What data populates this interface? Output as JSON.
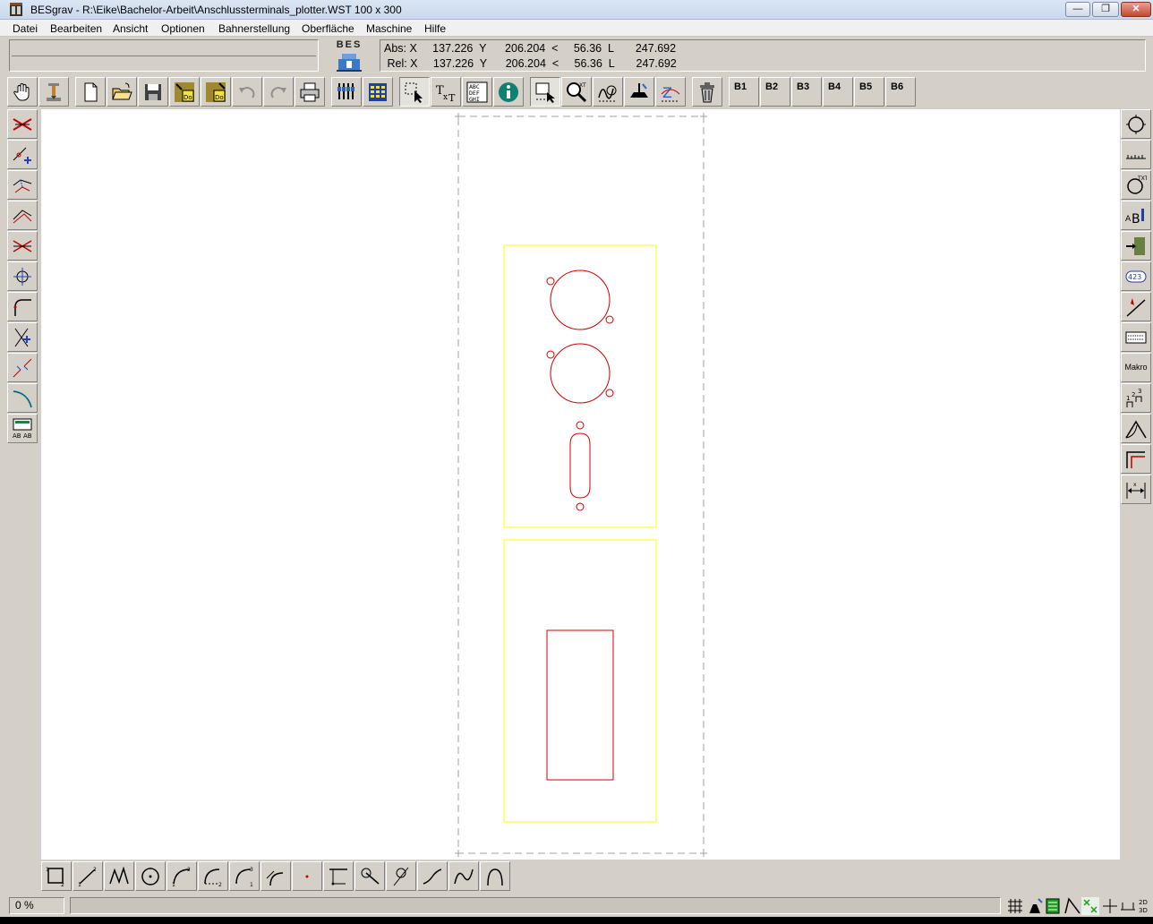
{
  "window": {
    "title": "BESgrav - R:\\Eike\\Bachelor-Arbeit\\Anschlussterminals_plotter.WST   100 x 300",
    "minimize_label": "—",
    "maximize_label": "❐",
    "close_label": "✕"
  },
  "menu": [
    {
      "label": "Datei"
    },
    {
      "label": "Bearbeiten"
    },
    {
      "label": "Ansicht"
    },
    {
      "label": "Optionen"
    },
    {
      "label": "Bahnerstellung"
    },
    {
      "label": "Oberfläche"
    },
    {
      "label": "Maschine"
    },
    {
      "label": "Hilfe"
    }
  ],
  "logo_text": "BES",
  "coords": {
    "abs_line": "Abs: X     137.226  Y      206.204  <     56.36  L       247.692",
    "rel_line": " Rel: X     137.226  Y      206.204  <     56.36  L       247.692"
  },
  "toolbar": {
    "buttons": [
      {
        "icon": "hand-icon"
      },
      {
        "icon": "machine-icon"
      },
      {
        "icon": "new-file-icon"
      },
      {
        "icon": "open-folder-icon"
      },
      {
        "icon": "save-icon"
      },
      {
        "icon": "import-icon"
      },
      {
        "icon": "export-icon"
      },
      {
        "icon": "undo-icon"
      },
      {
        "icon": "redo-icon"
      },
      {
        "icon": "print-icon"
      },
      {
        "icon": "tools-icon"
      },
      {
        "icon": "calculator-icon"
      },
      {
        "icon": "select-icon"
      },
      {
        "icon": "text-icon"
      },
      {
        "icon": "font-icon"
      },
      {
        "icon": "info-icon"
      },
      {
        "icon": "window-select-icon"
      },
      {
        "icon": "zoom-icon"
      },
      {
        "icon": "zoom-all-icon"
      },
      {
        "icon": "centerline-icon"
      },
      {
        "icon": "path-icon"
      },
      {
        "icon": "delete-icon"
      }
    ],
    "macro_buttons": [
      "B1",
      "B2",
      "B3",
      "B4",
      "B5",
      "B6"
    ]
  },
  "right_toolbar": {
    "makro_label": "Makro"
  },
  "status": {
    "percent": "0 %",
    "progress": 0
  },
  "colors": {
    "panel_border": "#ffff00",
    "cut_lines": "#d00000",
    "sheet_border": "#a0a0a0"
  }
}
